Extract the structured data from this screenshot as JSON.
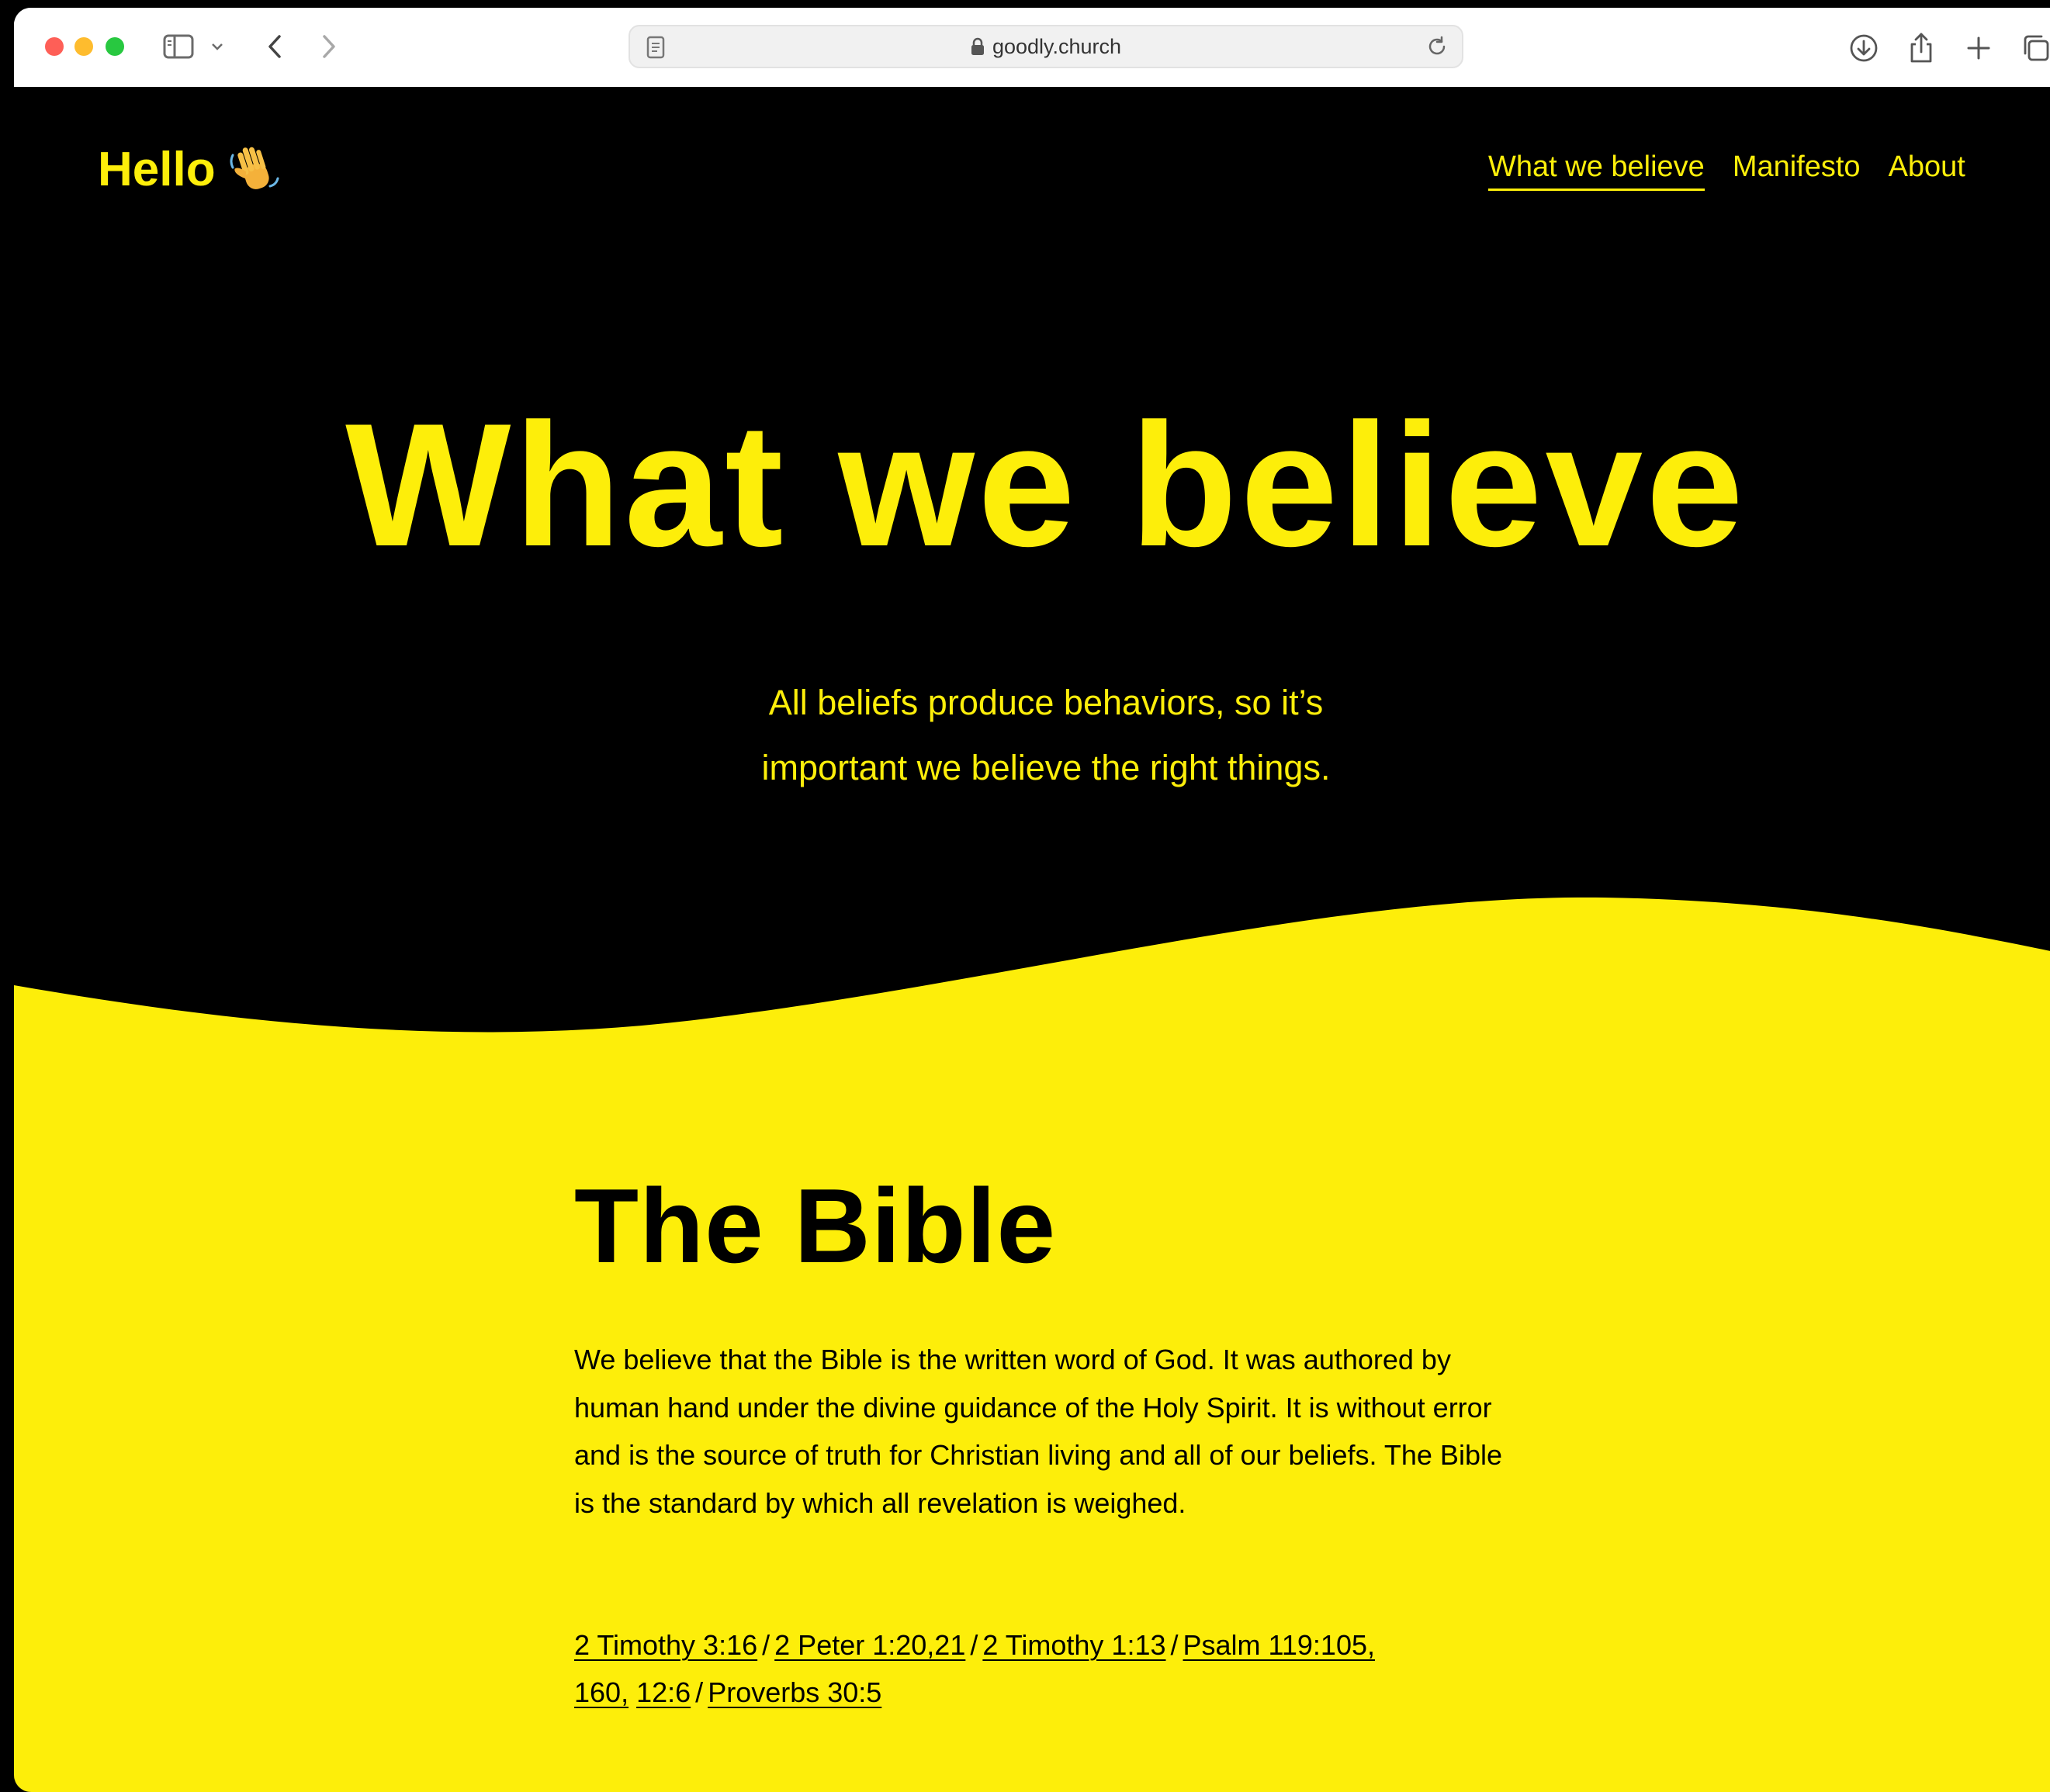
{
  "browser": {
    "url": "goodly.church"
  },
  "site": {
    "logo_text": "Hello",
    "logo_icon": "waving-hand-icon"
  },
  "nav": {
    "items": [
      {
        "label": "What we believe",
        "active": true
      },
      {
        "label": "Manifesto",
        "active": false
      },
      {
        "label": "About",
        "active": false
      }
    ]
  },
  "hero": {
    "title": "What we believe",
    "subtitle_line1": "All beliefs produce behaviors, so it’s",
    "subtitle_line2": "important we believe the right things."
  },
  "section": {
    "title": "The Bible",
    "body": "We believe that the Bible is the written word of God. It was authored by human hand under the divine guidance of the Holy Spirit. It is without error and is the source of truth for Christian living and all of our beliefs. The Bible is the standard by which all revelation is weighed.",
    "refs": {
      "r1": "2 Timothy 3:16",
      "r2": "2 Peter 1:20,21",
      "r3": "2 Timothy 1:13",
      "r4": "Psalm 119:105,",
      "r5": "160,",
      "r6": "12:6",
      "r7": "Proverbs 30:5",
      "separator": "/"
    }
  },
  "colors": {
    "brand_yellow": "#fdee0a",
    "background": "#000000"
  }
}
